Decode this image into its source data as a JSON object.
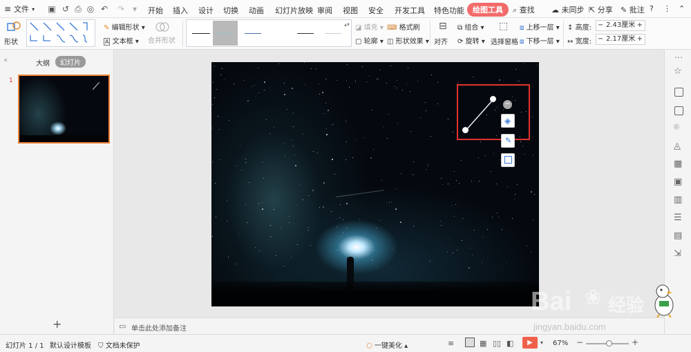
{
  "menubar": {
    "file_label": "文件",
    "tabs": [
      "开始",
      "插入",
      "设计",
      "切换",
      "动画",
      "幻灯片放映",
      "审阅",
      "视图",
      "安全",
      "开发工具",
      "特色功能"
    ],
    "active_tab": "绘图工具",
    "search": "查找",
    "sync": "未同步",
    "share": "分享",
    "comment": "批注",
    "help": "?"
  },
  "ribbon": {
    "shape": "形状",
    "edit_shape": "编辑形状",
    "textbox": "文本框",
    "merge_shape": "合并形状",
    "fill": "填充",
    "format_brush": "格式刷",
    "outline": "轮廓",
    "shape_effect": "形状效果",
    "align": "对齐",
    "group": "组合",
    "rotate": "旋转",
    "selection_pane": "选择窗格",
    "bring_forward": "上移一层",
    "send_backward": "下移一层",
    "height_label": "高度:",
    "height_value": "2.43厘米",
    "width_label": "宽度:",
    "width_value": "2.17厘米"
  },
  "left_panel": {
    "tab_outline": "大纲",
    "tab_slides": "幻灯片",
    "slide_number": "1",
    "add_icon": "+"
  },
  "notes": {
    "placeholder": "单击此处添加备注"
  },
  "status": {
    "slide_counter": "幻灯片 1 / 1",
    "template": "默认设计模板",
    "protect": "文档未保护",
    "beautify": "一键美化",
    "zoom": "67%"
  },
  "watermark": {
    "brand_latin": "Bai",
    "brand_cn": "经验",
    "url": "jingyan.baidu.com"
  },
  "colors": {
    "accent": "#f26b6b",
    "selection": "#e2332f",
    "thumb_border": "#f0863a",
    "play": "#f0604a"
  }
}
